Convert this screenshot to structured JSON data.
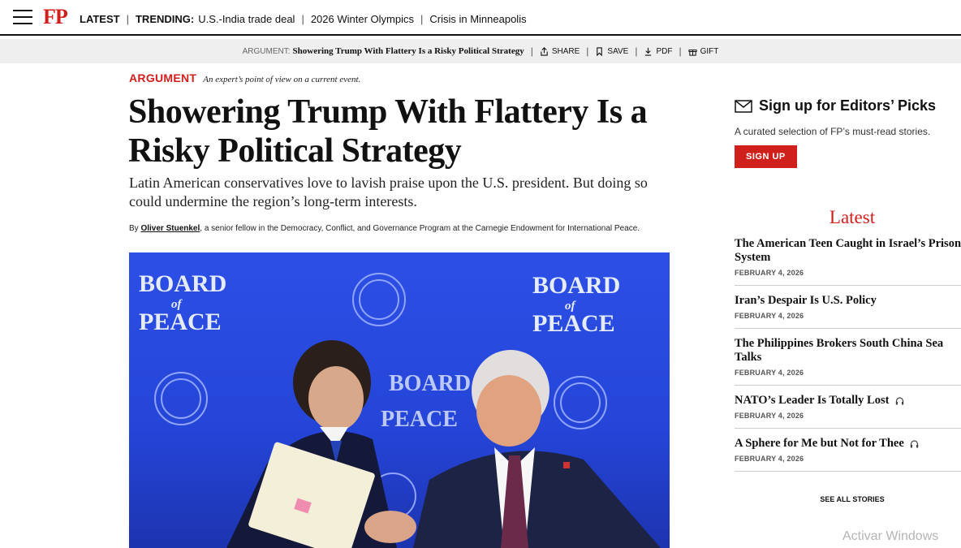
{
  "nav": {
    "logo": "FP",
    "latest": "LATEST",
    "trending_label": "TRENDING:",
    "trending": [
      "U.S.-India trade deal",
      "2026 Winter Olympics",
      "Crisis in Minneapolis"
    ]
  },
  "sharebar": {
    "label": "ARGUMENT:",
    "title": "Showering Trump With Flattery Is a Risky Political Strategy",
    "share": "SHARE",
    "save": "SAVE",
    "pdf": "PDF",
    "gift": "GIFT"
  },
  "article": {
    "category": "ARGUMENT",
    "category_desc": "An expert’s point of view on a current event.",
    "headline": "Showering Trump With Flattery Is a Risky Political Strategy",
    "dek": "Latin American conservatives love to lavish praise upon the U.S. president. But doing so could undermine the region’s long-term interests.",
    "by": "By",
    "author": "Oliver Stuenkel",
    "author_desc": ", a senior fellow in the Democracy, Conflict, and Governance Program at the Carnegie Endowment for International Peace.",
    "photo": {
      "backdrop_text": "BOARD of PEACE",
      "backdrop_line1": "BOARD",
      "backdrop_line2": "of",
      "backdrop_line3": "PEACE"
    }
  },
  "sidebar": {
    "signup_title": "Sign up for Editors’ Picks",
    "signup_sub": "A curated selection of FP’s must-read stories.",
    "signup_button": "SIGN UP",
    "latest_title": "Latest",
    "stories": [
      {
        "title": "The American Teen Caught in Israel’s Prison System",
        "date": "FEBRUARY 4, 2026",
        "audio": false
      },
      {
        "title": "Iran’s Despair Is U.S. Policy",
        "date": "FEBRUARY 4, 2026",
        "audio": false
      },
      {
        "title": "The Philippines Brokers South China Sea Talks",
        "date": "FEBRUARY 4, 2026",
        "audio": false
      },
      {
        "title": "NATO’s Leader Is Totally Lost",
        "date": "FEBRUARY 4, 2026",
        "audio": true
      },
      {
        "title": "A Sphere for Me but Not for Thee",
        "date": "FEBRUARY 4, 2026",
        "audio": true
      }
    ],
    "see_all": "SEE ALL STORIES"
  },
  "watermark": "Activar Windows",
  "colors": {
    "accent": "#d0201c",
    "photo_bg": "#2545d8"
  }
}
